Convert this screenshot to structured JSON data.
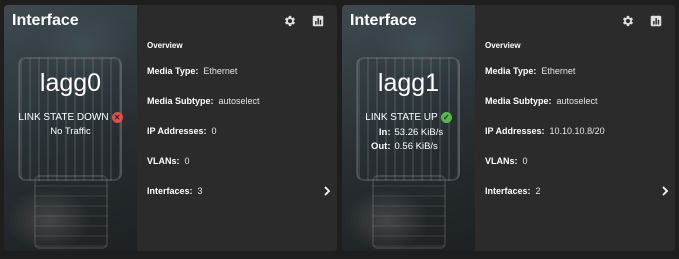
{
  "cards": [
    {
      "title": "Interface",
      "name": "lagg0",
      "link_state": "LINK STATE DOWN",
      "link_status": "down",
      "traffic_text": "No Traffic",
      "overview_title": "Overview",
      "media_type_label": "Media Type:",
      "media_type": "Ethernet",
      "media_subtype_label": "Media Subtype:",
      "media_subtype": "autoselect",
      "ip_label": "IP Addresses:",
      "ip": "0",
      "vlans_label": "VLANs:",
      "vlans": "0",
      "interfaces_label": "Interfaces:",
      "interfaces": "3"
    },
    {
      "title": "Interface",
      "name": "lagg1",
      "link_state": "LINK STATE UP",
      "link_status": "up",
      "in_label": "In:",
      "in_value": "53.26 KiB/s",
      "out_label": "Out:",
      "out_value": "0.56 KiB/s",
      "overview_title": "Overview",
      "media_type_label": "Media Type:",
      "media_type": "Ethernet",
      "media_subtype_label": "Media Subtype:",
      "media_subtype": "autoselect",
      "ip_label": "IP Addresses:",
      "ip": "10.10.10.8/20",
      "vlans_label": "VLANs:",
      "vlans": "0",
      "interfaces_label": "Interfaces:",
      "interfaces": "2"
    }
  ],
  "icons": {
    "settings": "gear-icon",
    "reports": "bar-chart-icon",
    "expand": "chevron-right-icon",
    "link_down": "error-x-circle-icon",
    "link_up": "check-circle-icon"
  },
  "colors": {
    "card_bg": "#2b2b2b",
    "page_bg": "#1e1e1e",
    "link_down": "#e84b4b",
    "link_up": "#58b84c"
  }
}
